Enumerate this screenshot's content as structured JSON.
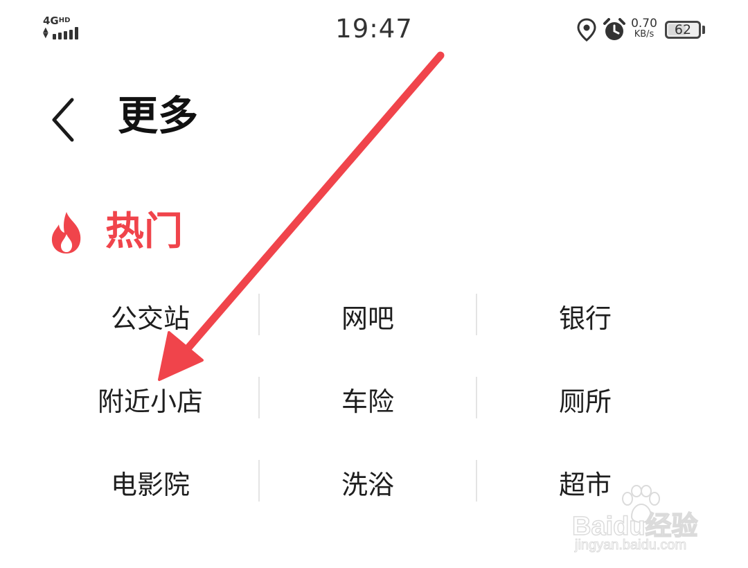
{
  "status_bar": {
    "network": "4G",
    "network_hd": "HD",
    "time": "19:47",
    "speed_value": "0.70",
    "speed_unit": "KB/s",
    "battery_level": "62",
    "battery_fraction": 0.62,
    "icons": [
      "signal-icon",
      "location-icon",
      "alarm-icon",
      "battery-icon"
    ]
  },
  "header": {
    "back_icon": "chevron-left-icon",
    "title": "更多"
  },
  "hot_section": {
    "icon": "fire-icon",
    "title": "热门",
    "accent_color": "#f0444b",
    "rows": [
      [
        "公交站",
        "网吧",
        "银行"
      ],
      [
        "附近小店",
        "车险",
        "厕所"
      ],
      [
        "电影院",
        "洗浴",
        "超市"
      ]
    ]
  },
  "annotation": {
    "type": "arrow",
    "color": "#f0444b",
    "points_to": "附近小店"
  },
  "watermark": {
    "brand": "Bai 经验",
    "brand_du": "du",
    "url": "jingyan.baidu.com"
  }
}
